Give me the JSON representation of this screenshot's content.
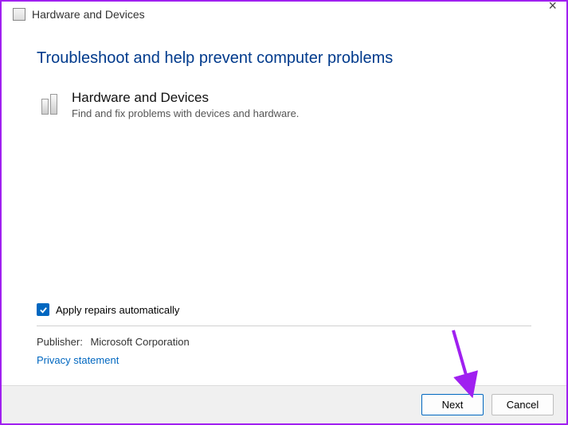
{
  "window": {
    "title": "Hardware and Devices"
  },
  "heading": "Troubleshoot and help prevent computer problems",
  "item": {
    "title": "Hardware and Devices",
    "description": "Find and fix problems with devices and hardware."
  },
  "apply_label": "Apply repairs automatically",
  "publisher": {
    "label": "Publisher:",
    "value": "Microsoft Corporation"
  },
  "privacy_link": "Privacy statement",
  "buttons": {
    "next": "Next",
    "cancel": "Cancel"
  }
}
